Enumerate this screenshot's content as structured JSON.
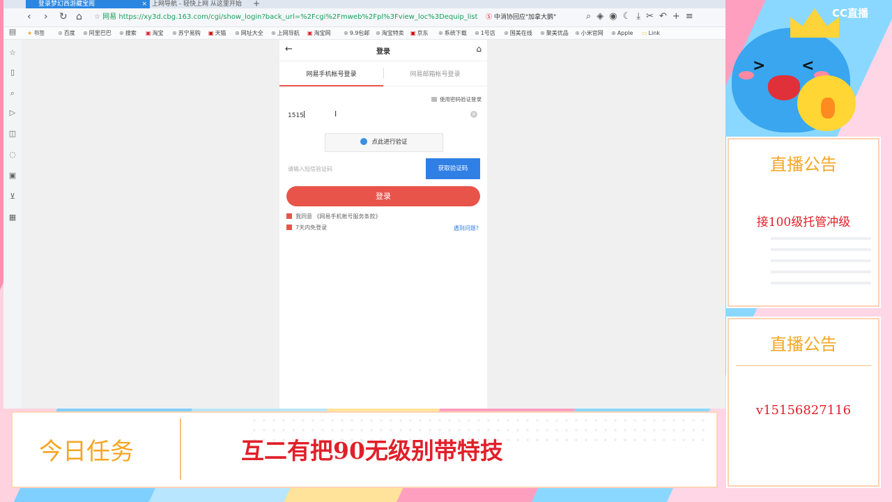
{
  "browser": {
    "tabs": [
      {
        "label": "登录梦幻西游藏宝阁",
        "active": true
      },
      {
        "label": "上网导航 - 轻快上网 从这里开始",
        "active": false
      }
    ],
    "url_site": "网易",
    "url": "https://xy3d.cbg.163.com/cgi/show_login?back_url=%2Fcgi%2Fmweb%2Fpl%3Fview_loc%3Dequip_list",
    "search_suggestion": "中消协回应\"加拿大鹅\"",
    "bookmarks": [
      "书签",
      "百度",
      "阿里巴巴",
      "搜索",
      "淘宝",
      "苏宁易购",
      "天猫",
      "网址大全",
      "上网导航",
      "淘宝网",
      "9.9包邮",
      "淘宝特卖",
      "京东",
      "系统下载",
      "1号店",
      "国美在线",
      "聚美优品",
      "小米官网",
      "Apple",
      "Link"
    ]
  },
  "login": {
    "title": "登录",
    "tab_phone": "网易手机帐号登录",
    "tab_email": "网易邮箱帐号登录",
    "password_login_link": "使用密码验证登录",
    "phone_value": "1515",
    "verify_button": "点此进行验证",
    "sms_placeholder": "请输入短信验证码",
    "get_code_button": "获取验证码",
    "login_button": "登录",
    "agree_prefix": "我同意",
    "agree_terms": "《网易手机帐号服务条款》",
    "remember_label": "7天内免登录",
    "problem_link": "遇到问题?"
  },
  "overlay": {
    "logo_text": "CC直播",
    "notice1_title": "直播公告",
    "notice1_body": "接100级托管冲级",
    "notice2_title": "直播公告",
    "notice2_body": "v15156827116",
    "task_label": "今日任务",
    "task_text": "互二有把90无级别带特技"
  },
  "colors": {
    "accent_red": "#e8544a",
    "button_blue": "#2f7fe5",
    "notice_orange": "#f5a623",
    "notice_red": "#e0202a"
  }
}
